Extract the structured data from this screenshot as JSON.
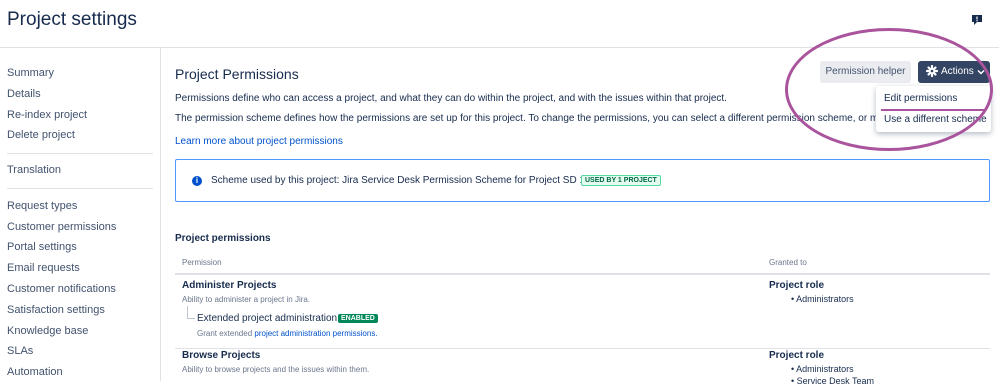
{
  "page": {
    "title": "Project settings"
  },
  "sidebar": {
    "items": [
      "Summary",
      "Details",
      "Re-index project",
      "Delete project",
      "Translation",
      "Request types",
      "Customer permissions",
      "Portal settings",
      "Email requests",
      "Customer notifications",
      "Satisfaction settings",
      "Knowledge base",
      "SLAs",
      "Automation"
    ]
  },
  "main": {
    "title": "Project Permissions",
    "desc1": "Permissions define who can access a project, and what they can do within the project, and with the issues within that project.",
    "desc2": "The permission scheme defines how the permissions are set up for this project. To change the permissions, you can select a different permission scheme, or modify",
    "learn_more": "Learn more about project permissions",
    "info": {
      "text": "Scheme used by this project: Jira Service Desk Permission Scheme for Project SD 1",
      "badge": "USED BY 1 PROJECT"
    },
    "section_title": "Project permissions",
    "table": {
      "headers": [
        "Permission",
        "Granted to"
      ],
      "rows": [
        {
          "name": "Administer Projects",
          "desc": "Ability to administer a project in Jira.",
          "extended": {
            "name": "Extended project administration",
            "badge": "ENABLED",
            "desc_prefix": "Grant extended ",
            "desc_link": "project administration permissions."
          },
          "grant_title": "Project role",
          "grant_items": [
            "Administrators"
          ]
        },
        {
          "name": "Browse Projects",
          "desc": "Ability to browse projects and the issues within them.",
          "grant_title": "Project role",
          "grant_items": [
            "Administrators",
            "Service Desk Team"
          ]
        }
      ]
    }
  },
  "toolbar": {
    "helper_label": "Permission helper",
    "actions_label": "Actions",
    "dropdown": [
      "Edit permissions",
      "Use a different scheme"
    ]
  },
  "colors": {
    "annotation": "#a9549c",
    "primary_button": "#344563",
    "link": "#0052cc"
  },
  "icons": [
    "feedback-icon",
    "gear-icon",
    "chevron-down-icon",
    "info-icon"
  ]
}
